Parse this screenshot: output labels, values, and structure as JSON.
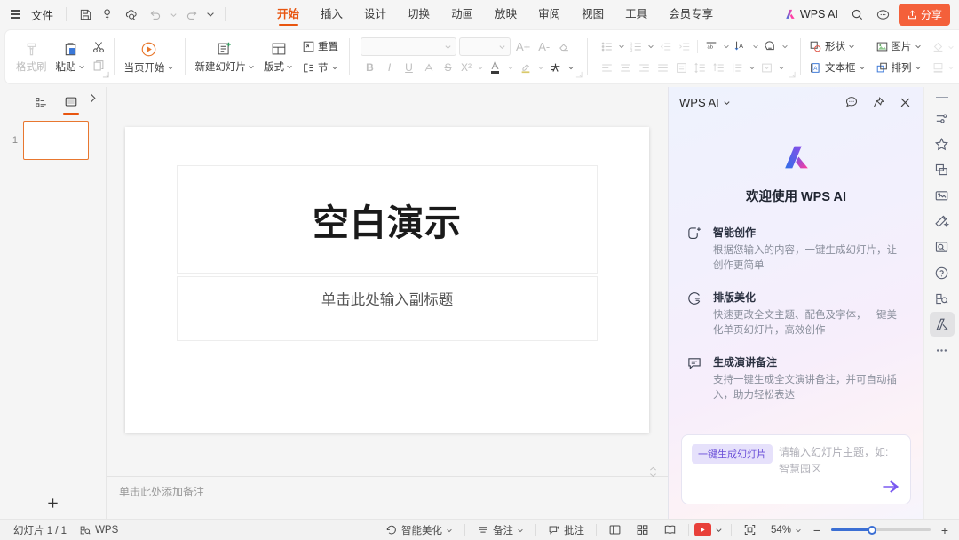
{
  "menubar": {
    "file_label": "文件",
    "quick_icons": [
      "save-icon",
      "link-icon",
      "cloud-search-icon",
      "undo-icon",
      "redo-icon",
      "more-quick-icon"
    ],
    "tabs": [
      {
        "label": "开始",
        "active": true
      },
      {
        "label": "插入",
        "active": false
      },
      {
        "label": "设计",
        "active": false
      },
      {
        "label": "切换",
        "active": false
      },
      {
        "label": "动画",
        "active": false
      },
      {
        "label": "放映",
        "active": false
      },
      {
        "label": "审阅",
        "active": false
      },
      {
        "label": "视图",
        "active": false
      },
      {
        "label": "工具",
        "active": false
      },
      {
        "label": "会员专享",
        "active": false
      }
    ],
    "wps_ai_label": "WPS AI",
    "search_icon": "search-icon",
    "cloud_icon": "cloud-status-icon",
    "share_label": "分享"
  },
  "ribbon": {
    "clipboard": {
      "format_painter": "格式刷",
      "paste": "粘贴",
      "copy_icon": "copy-icon",
      "cut_icon": "cut-icon"
    },
    "play": {
      "start_here": "当页开始"
    },
    "slides": {
      "new_slide": "新建幻灯片",
      "layout": "版式",
      "reset": "重置",
      "section": "节"
    },
    "font": {
      "font_family_value": "",
      "font_size_value": "",
      "grow_font": "A+",
      "shrink_font": "A-",
      "clear_format": "clear-format-icon",
      "bold": "B",
      "italic": "I",
      "underline": "U",
      "text_effect": "A",
      "strikethrough": "S",
      "superscript": "X²",
      "font_color": "A",
      "highlight": "highlight-icon",
      "char_art": "char-art-icon"
    },
    "paragraph": {
      "bullets": "bullets-icon",
      "numbering": "numbering-icon",
      "decrease_indent": "decrease-indent-icon",
      "increase_indent": "increase-indent-icon",
      "text_direction": "text-direction-icon",
      "align_text": "align-text-icon",
      "convert_smartart": "smartart-icon",
      "align_left": "align-left-icon",
      "align_center": "align-center-icon",
      "align_right": "align-right-icon",
      "justify": "justify-icon",
      "distribute": "distribute-icon",
      "line_spacing": "line-spacing-icon",
      "paragraph_spacing": "paragraph-spacing-icon",
      "columns": "columns-icon",
      "select_pane": "select-pane-icon"
    },
    "insert": {
      "shape": "形状",
      "picture": "图片",
      "textbox": "文本框",
      "arrange": "排列",
      "expander": "chevron-right-icon"
    }
  },
  "slide_panel": {
    "tab_outline_icon": "outline-view-icon",
    "tab_slides_icon": "slide-view-icon",
    "expand_icon": "chevron-right-icon",
    "thumbnails": [
      {
        "number": "1"
      }
    ],
    "add_slide_icon": "plus-icon"
  },
  "slide": {
    "title": "空白演示",
    "subtitle": "单击此处输入副标题"
  },
  "notes": {
    "placeholder": "单击此处添加备注"
  },
  "ai_panel": {
    "title": "WPS AI",
    "chat_icon": "chat-icon",
    "pin_icon": "pin-icon",
    "close_icon": "close-icon",
    "logo": "wps-ai-logo",
    "welcome": "欢迎使用 WPS AI",
    "features": [
      {
        "icon": "smart-create-icon",
        "title": "智能创作",
        "desc": "根据您输入的内容，一键生成幻灯片，让创作更简单"
      },
      {
        "icon": "beautify-icon",
        "title": "排版美化",
        "desc": "快速更改全文主题、配色及字体，一键美化单页幻灯片，高效创作"
      },
      {
        "icon": "speaker-notes-icon",
        "title": "生成演讲备注",
        "desc": "支持一键生成全文演讲备注，并可自动插入，助力轻松表达"
      }
    ],
    "input": {
      "chip": "一键生成幻灯片",
      "placeholder": "请输入幻灯片主题，如: 智慧园区",
      "send_icon": "send-icon"
    }
  },
  "rail": {
    "items": [
      {
        "icon": "properties-icon",
        "selected": false
      },
      {
        "icon": "star-icon",
        "selected": false
      },
      {
        "icon": "duplicate-icon",
        "selected": false
      },
      {
        "icon": "design-ideas-icon",
        "selected": false
      },
      {
        "icon": "magic-wand-icon",
        "selected": false
      },
      {
        "icon": "image-search-icon",
        "selected": false
      },
      {
        "icon": "help-icon",
        "selected": false
      },
      {
        "icon": "feedback-icon",
        "selected": false
      },
      {
        "icon": "wps-ai-rail-icon",
        "selected": true
      },
      {
        "icon": "more-icon",
        "selected": false
      }
    ]
  },
  "status": {
    "slide_count": "幻灯片 1 / 1",
    "wps_label": "WPS",
    "wps_icon": "wps-spellcheck-icon",
    "smart_beautify": "智能美化",
    "notes_label": "备注",
    "comment_label": "批注",
    "view_normal_icon": "normal-view-icon",
    "view_sorter_icon": "slide-sorter-icon",
    "view_reading_icon": "reading-view-icon",
    "play_icon": "play-icon",
    "fit_icon": "fit-slide-icon",
    "zoom_value": "54%",
    "zoom_out": "−",
    "zoom_in": "+"
  },
  "colors": {
    "accent": "#e8550f",
    "share": "#f4603a",
    "ai_purple": "#6a4fd8",
    "play_red": "#e8403a",
    "zoom_blue": "#3b6fd4"
  }
}
